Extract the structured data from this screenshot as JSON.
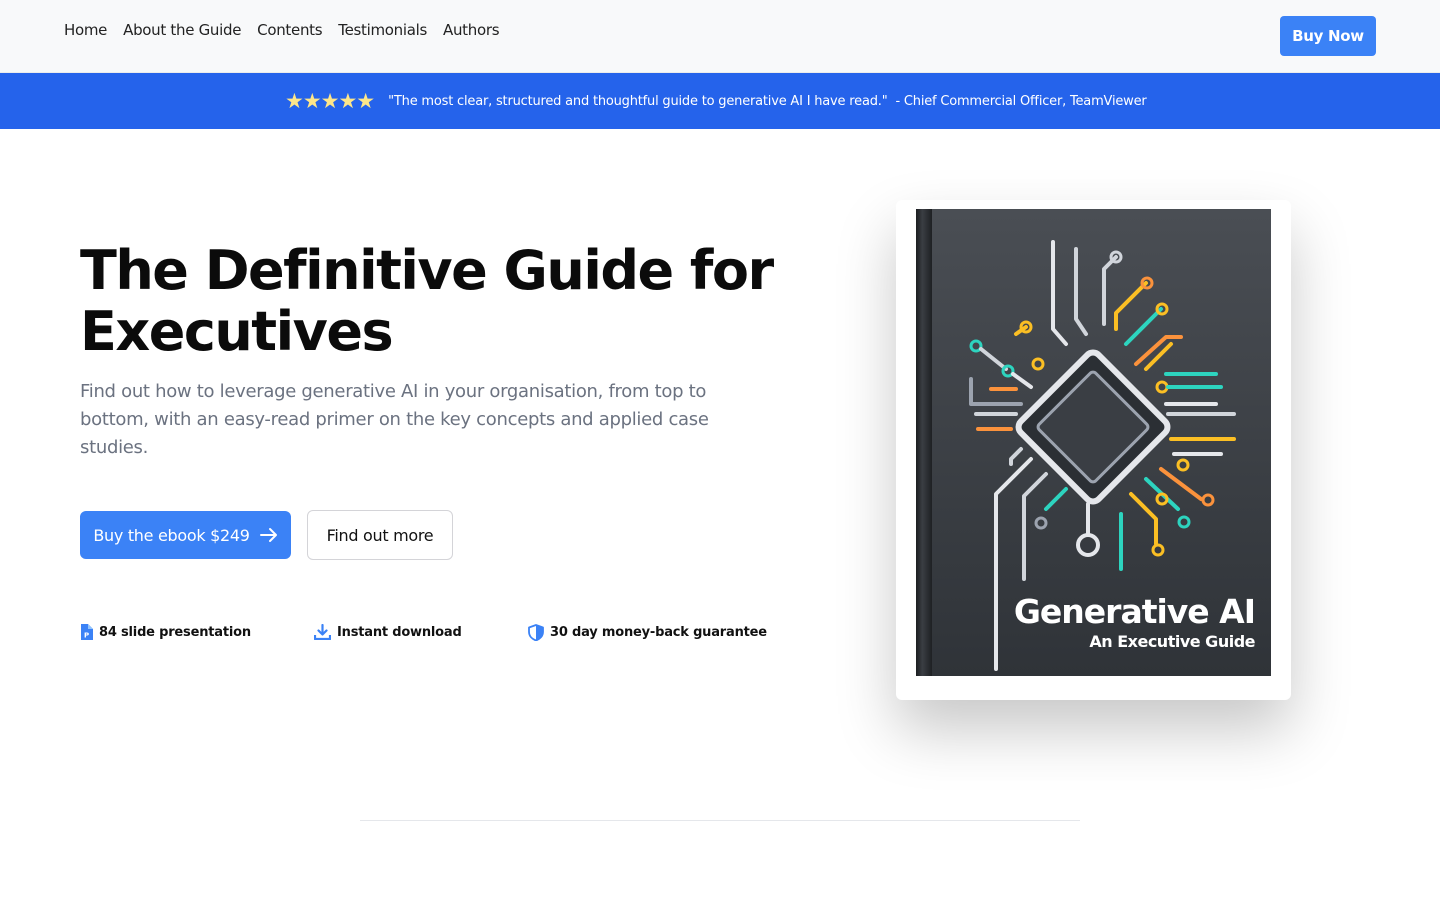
{
  "nav": {
    "links": [
      "Home",
      "About the Guide",
      "Contents",
      "Testimonials",
      "Authors"
    ],
    "buy_label": "Buy Now"
  },
  "banner": {
    "stars": "★★★★★",
    "quote": "\"The most clear, structured and thoughtful guide to generative AI I have read.\"",
    "attribution": "- Chief Commercial Officer, TeamViewer"
  },
  "hero": {
    "title": "The Definitive Guide for Executives",
    "subtitle": "Find out how to leverage generative AI in your organisation, from top to bottom, with an easy-read primer on the key concepts and applied case studies.",
    "primary_button": "Buy the ebook $249",
    "secondary_button": "Find out more",
    "features": [
      {
        "icon": "slides-file-icon",
        "label": "84 slide presentation"
      },
      {
        "icon": "download-icon",
        "label": "Instant download"
      },
      {
        "icon": "shield-icon",
        "label": "30 day money-back guarantee"
      }
    ]
  },
  "book": {
    "title": "Generative AI",
    "subtitle": "An Executive Guide"
  },
  "colors": {
    "accent": "#3b82f6",
    "banner": "#2563eb",
    "stars": "#fde68a"
  }
}
